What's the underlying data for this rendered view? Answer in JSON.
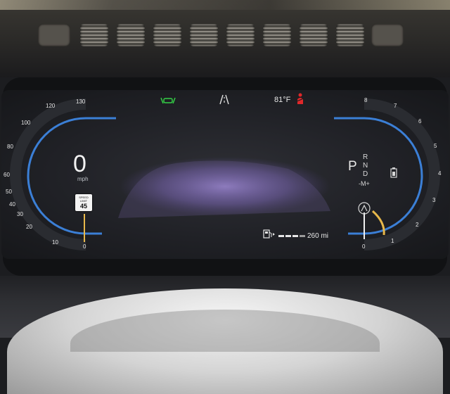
{
  "speedometer": {
    "speed": "0",
    "unit": "mph",
    "tick_labels": [
      "0",
      "10",
      "20",
      "30",
      "40",
      "50",
      "60",
      "80",
      "100",
      "120",
      "130"
    ],
    "speed_limit": {
      "line1": "SPEED",
      "line2": "LIMIT",
      "value": "45"
    }
  },
  "top_bar": {
    "outside_temp": "81°F"
  },
  "tachometer": {
    "tick_labels": [
      "0",
      "1",
      "2",
      "3",
      "4",
      "5",
      "6",
      "7",
      "8"
    ],
    "gear": "P",
    "gear_sequence": [
      "R",
      "N",
      "D"
    ],
    "manual_mode": "-M+"
  },
  "range_display": {
    "range": "260 mi"
  },
  "icons": [
    "lane-assist-icon",
    "road-lane-icon",
    "seatbelt-warning-icon",
    "fuel-pump-icon",
    "battery-icon",
    "eco-gauge-icon"
  ],
  "colors": {
    "gauge_ring": "#3b7fd6",
    "needle_white": "#f0f0f0",
    "needle_amber": "#e8b84a",
    "lane_assist_green": "#34d046",
    "warning_red": "#e0282a",
    "background_glow": "#a98ee8"
  }
}
